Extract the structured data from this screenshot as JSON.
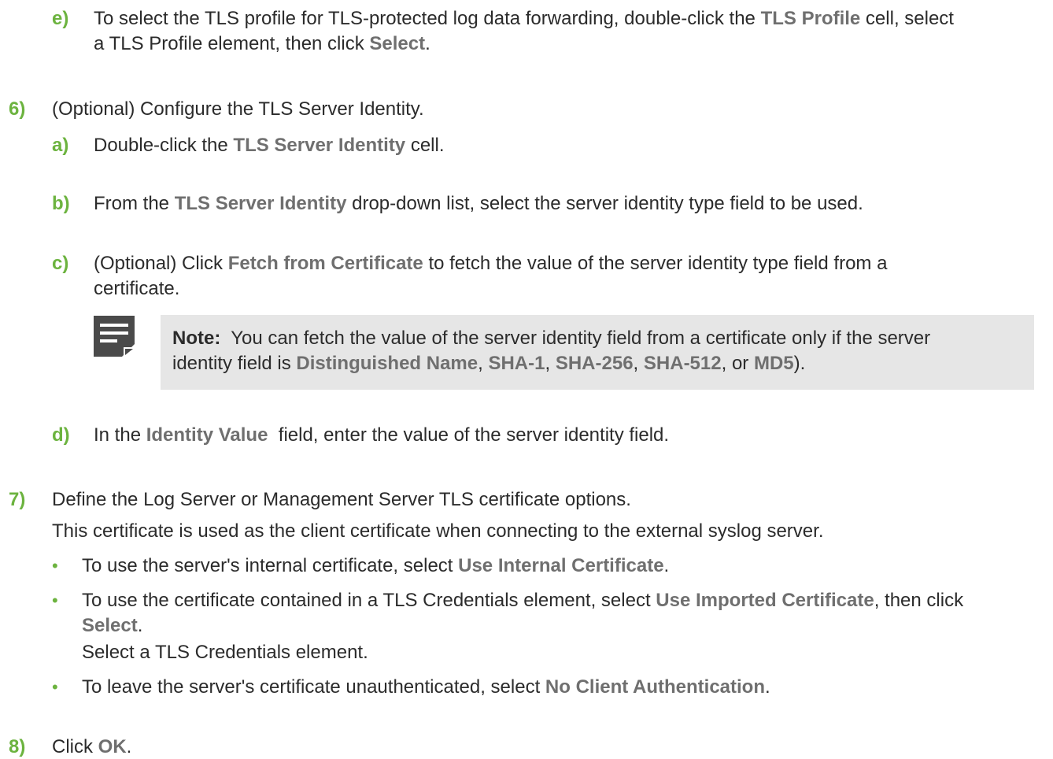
{
  "steps": {
    "step5e": {
      "num": "e)",
      "line1_a": "To select the TLS profile for TLS-protected log data forwarding, double-click the ",
      "line1_ui": "TLS Profile",
      "line1_b": " cell, select",
      "line2_a": "a TLS Profile element, then click ",
      "line2_ui": "Select",
      "line2_b": "."
    },
    "step6": {
      "num": "6)",
      "text": "(Optional) Configure the TLS Server Identity.",
      "a": {
        "num": "a)",
        "t1": "Double-click the ",
        "ui": "TLS Server Identity",
        "t2": " cell."
      },
      "b": {
        "num": "b)",
        "t1": "From the ",
        "ui": "TLS Server Identity",
        "t2": " drop-down list, select the server identity type field to be used."
      },
      "c": {
        "num": "c)",
        "t1": "(Optional) Click ",
        "ui": "Fetch from Certificate",
        "t2": " to fetch the value of the server identity type field from a",
        "t3": "certificate."
      },
      "note": {
        "icon": "note-icon",
        "label": "Note:",
        "t1": "  You can fetch the value of the server identity field from a certificate only if the server",
        "t2": "identity field is ",
        "ui1": "Distinguished Name",
        "s1": ", ",
        "ui2": "SHA-1",
        "s2": ", ",
        "ui3": "SHA-256",
        "s3": ", ",
        "ui4": "SHA-512",
        "s4": ", or ",
        "ui5": "MD5",
        "s5": ")."
      },
      "d": {
        "num": "d)",
        "t1": "In the ",
        "ui": "Identity Value",
        "t2": "  field, enter the value of the server identity field."
      }
    },
    "step7": {
      "num": "7)",
      "text": "Define the Log Server or Management Server TLS certificate options.",
      "info": "This certificate is used as the client certificate when connecting to the external syslog server.",
      "bullets": [
        {
          "bullet": "•",
          "t1": "To use the server's internal certificate, select ",
          "ui": "Use Internal Certificate",
          "t2": "."
        },
        {
          "bullet": "•",
          "t1": "To use the certificate contained in a TLS Credentials element, select ",
          "ui": "Use Imported Certificate",
          "t2": ", then click",
          "ui2": "Select",
          "t3": ".",
          "t4": "Select a TLS Credentials element."
        },
        {
          "bullet": "•",
          "t1": "To leave the server's certificate unauthenticated, select ",
          "ui": "No Client Authentication",
          "t2": "."
        }
      ]
    },
    "step8": {
      "num": "8)",
      "t1": "Click ",
      "ui": "OK",
      "t2": "."
    }
  },
  "colors": {
    "accent_green": "#6cb33f",
    "ui_gray": "#6f6f6f",
    "note_bg": "#e6e6e6",
    "icon_dark": "#4a4a4a"
  }
}
